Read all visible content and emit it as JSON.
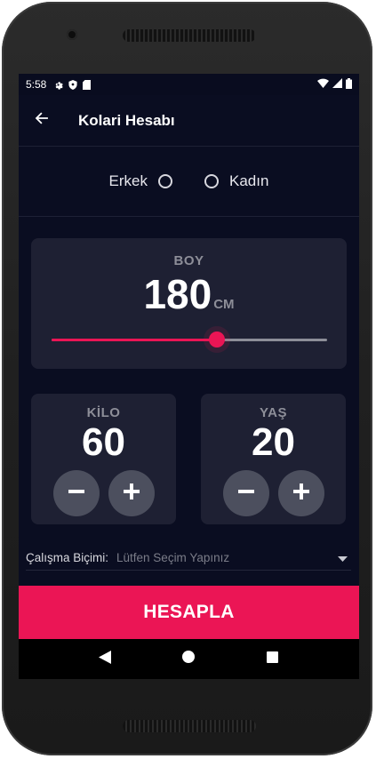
{
  "status": {
    "time": "5:58",
    "left_icons": [
      "settings-gear-icon",
      "shield-icon",
      "sd-card-icon"
    ],
    "right_icons": [
      "wifi-icon",
      "signal-icon",
      "battery-icon"
    ]
  },
  "appbar": {
    "back_icon": "arrow-back-icon",
    "title": "Kolari Hesabı"
  },
  "gender": {
    "male_label": "Erkek",
    "female_label": "Kadın",
    "selected": null
  },
  "height": {
    "label": "BOY",
    "value": "180",
    "unit": "CM",
    "slider_fraction": 0.6
  },
  "weight": {
    "label": "KİLO",
    "value": "60"
  },
  "age": {
    "label": "YAŞ",
    "value": "20"
  },
  "work": {
    "label": "Çalışma Biçimi:",
    "placeholder": "Lütfen Seçim Yapınız"
  },
  "calculate_label": "HESAPLA",
  "colors": {
    "background": "#0a0d21",
    "card": "#1e2033",
    "accent": "#eb1555",
    "muted_text": "#8d8e98",
    "round_button": "#4c4f5e"
  },
  "navbar": {
    "icons": [
      "back-triangle-icon",
      "home-circle-icon",
      "recents-square-icon"
    ]
  }
}
